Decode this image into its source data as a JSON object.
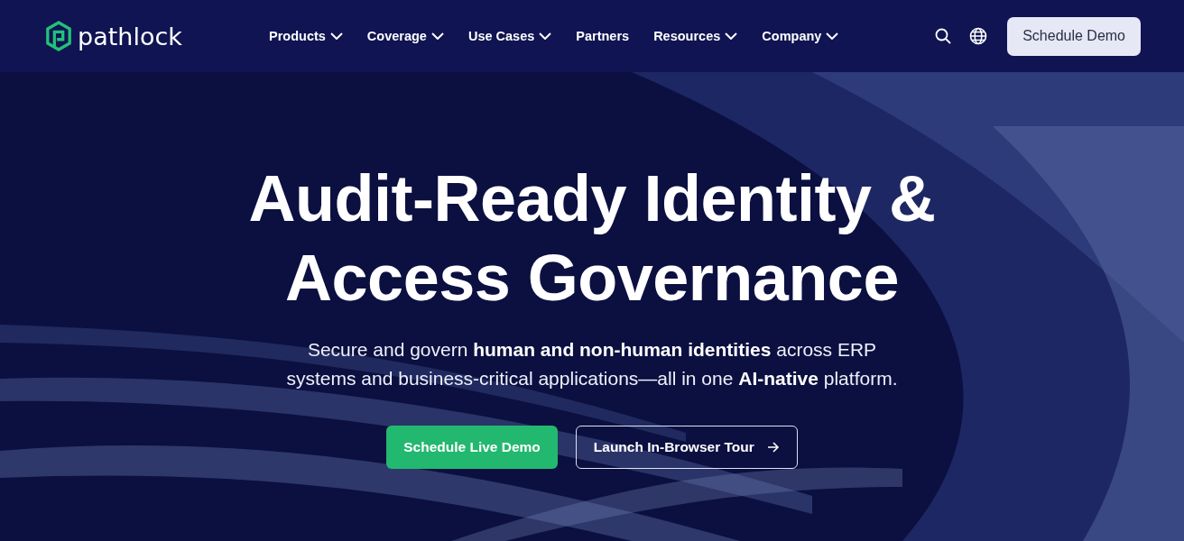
{
  "header": {
    "logo": "pathlock",
    "nav": [
      {
        "label": "Products",
        "has_menu": true
      },
      {
        "label": "Coverage",
        "has_menu": true
      },
      {
        "label": "Use Cases",
        "has_menu": true
      },
      {
        "label": "Partners",
        "has_menu": false
      },
      {
        "label": "Resources",
        "has_menu": true
      },
      {
        "label": "Company",
        "has_menu": true
      }
    ],
    "cta": "Schedule Demo"
  },
  "hero": {
    "title_lines": [
      "Audit-Ready Identity &",
      "Access Governance"
    ],
    "subtitle_lines": [
      "Secure and govern **human and non-human identities** across ERP",
      "systems and business-critical applications—all in one **AI-native** platform."
    ],
    "buttons": [
      {
        "label": "Schedule Live Demo",
        "kind": "primary"
      },
      {
        "label": "Launch In-Browser Tour",
        "kind": "outline"
      }
    ]
  }
}
